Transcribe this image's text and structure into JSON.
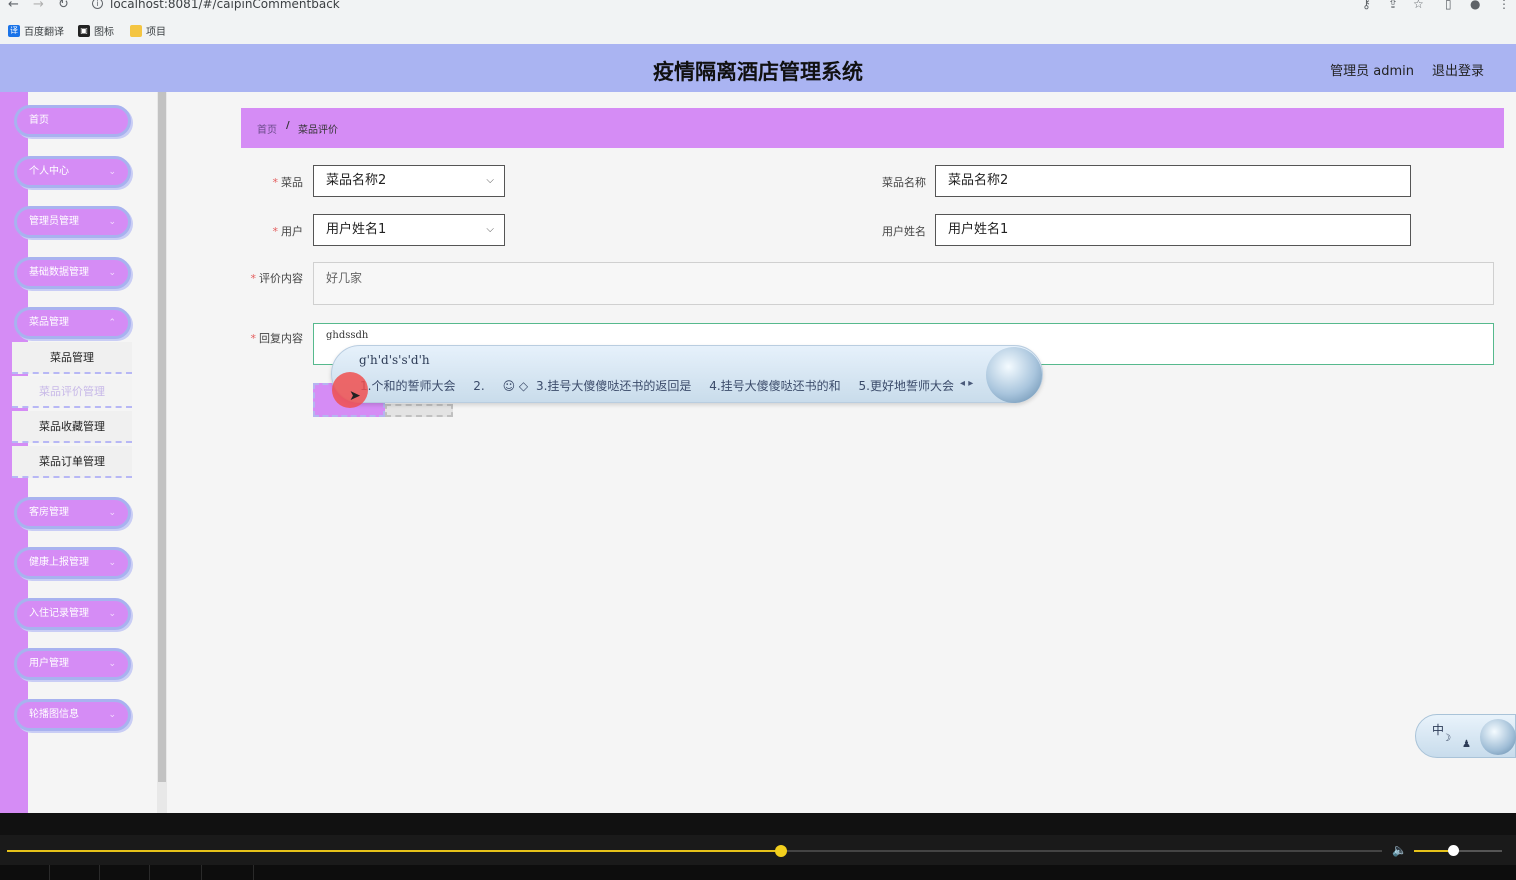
{
  "browser": {
    "url": "localhost:8081/#/caipinCommentback",
    "bookmarks": [
      {
        "label": "百度翻译",
        "icon": "translate-icon",
        "color": "#1a73e8"
      },
      {
        "label": "图标",
        "icon": "image-icon",
        "color": "#222222"
      },
      {
        "label": "项目",
        "icon": "folder-icon",
        "color": "#f4c542"
      }
    ]
  },
  "header": {
    "title": "疫情隔离酒店管理系统",
    "user_label": "管理员 admin",
    "logout_label": "退出登录",
    "color": "#aab4f2"
  },
  "sidebar": {
    "accent": "#d58cf5",
    "items": [
      {
        "label": "首页"
      },
      {
        "label": "个人中心"
      },
      {
        "label": "管理员管理"
      },
      {
        "label": "基础数据管理"
      },
      {
        "label": "菜品管理"
      },
      {
        "label": "客房管理"
      },
      {
        "label": "健康上报管理"
      },
      {
        "label": "入住记录管理"
      },
      {
        "label": "用户管理"
      },
      {
        "label": "轮播图信息"
      }
    ],
    "submenu": [
      {
        "label": "菜品管理"
      },
      {
        "label": "菜品评价管理"
      },
      {
        "label": "菜品收藏管理"
      },
      {
        "label": "菜品订单管理"
      }
    ]
  },
  "breadcrumb": {
    "home": "首页",
    "separator": "/",
    "current": "菜品评价"
  },
  "form": {
    "dish_label": "菜品",
    "dish_value": "菜品名称2",
    "dish_name_label": "菜品名称",
    "dish_name_value": "菜品名称2",
    "user_label": "用户",
    "user_value": "用户姓名1",
    "user_name_label": "用户姓名",
    "user_name_value": "用户姓名1",
    "comment_label": "评价内容",
    "comment_value": "好几家",
    "reply_label": "回复内容",
    "reply_value": "ghdssdh"
  },
  "ime": {
    "composition": "g'h'd's's'd'h",
    "candidates": [
      "1.个和的誓师大会",
      "2.",
      "3.挂号大傻傻哒还书的返回是",
      "4.挂号大傻傻哒还书的和",
      "5.更好地誓师大会"
    ],
    "mode": "中"
  },
  "player": {
    "progress": 0.5629,
    "volume": 0.44
  }
}
